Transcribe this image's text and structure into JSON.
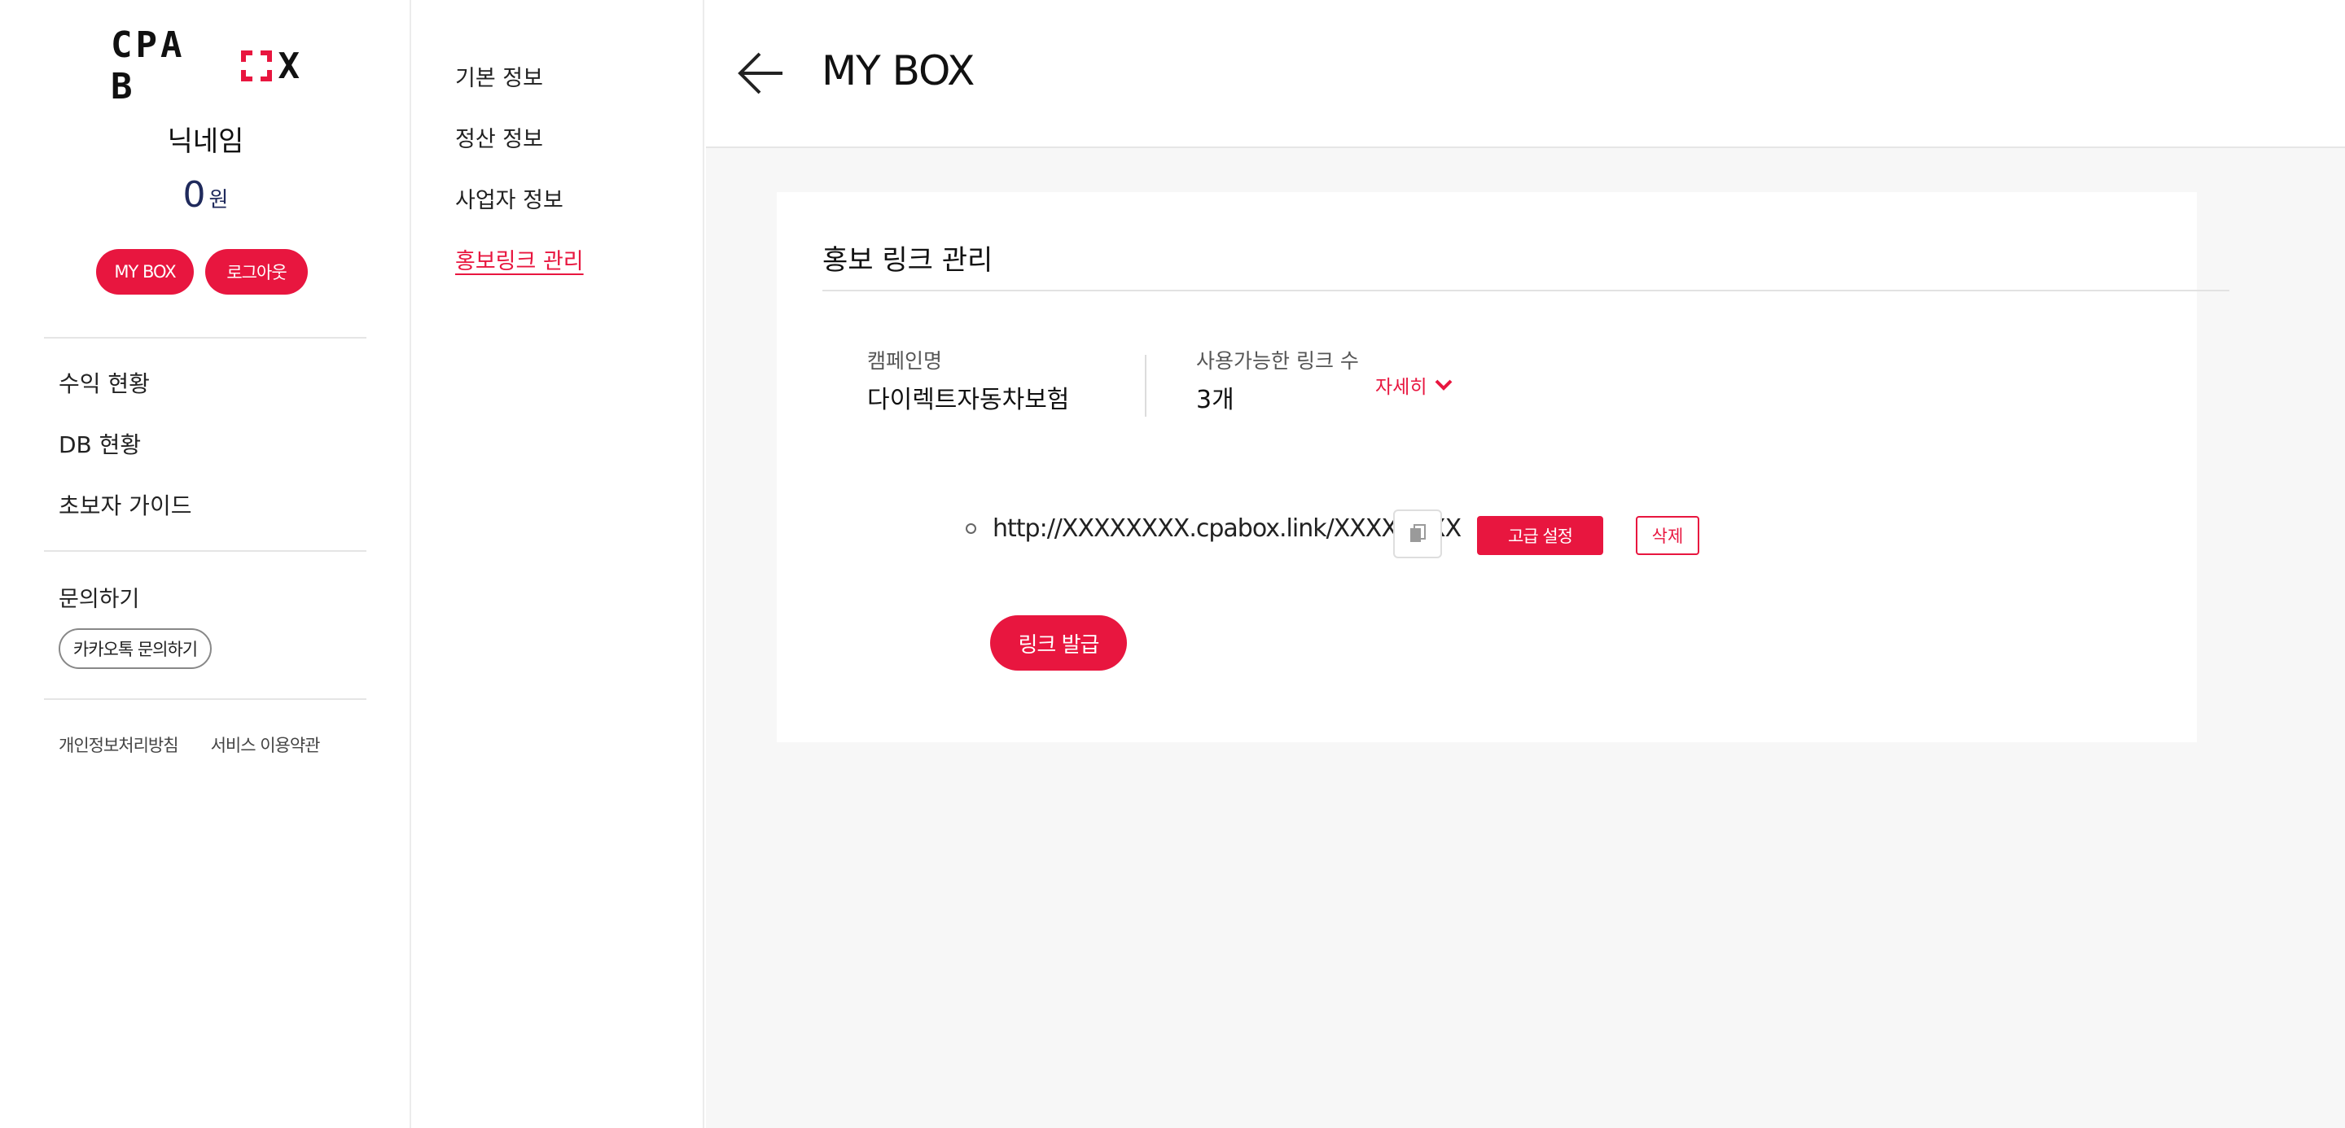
{
  "brand": {
    "logo_left": "CPA B",
    "logo_right": "X",
    "accent_color": "#e8163f"
  },
  "sidebar": {
    "nickname": "닉네임",
    "balance_value": "0",
    "balance_unit": "원",
    "mybox_label": "MY BOX",
    "logout_label": "로그아웃",
    "menu": [
      {
        "label": "수익 현황"
      },
      {
        "label": "DB 현황"
      },
      {
        "label": "초보자 가이드"
      }
    ],
    "inquiry_title": "문의하기",
    "kakao_label": "카카오톡 문의하기",
    "footer": {
      "privacy": "개인정보처리방침",
      "terms": "서비스 이용약관"
    }
  },
  "subnav": {
    "items": [
      {
        "label": "기본 정보"
      },
      {
        "label": "정산 정보"
      },
      {
        "label": "사업자 정보"
      },
      {
        "label": "홍보링크 관리",
        "active": true
      }
    ]
  },
  "header": {
    "back_icon": "arrow-left-icon",
    "title": "MY BOX"
  },
  "promo": {
    "section_title": "홍보 링크 관리",
    "campaign_label": "캠페인명",
    "campaign_value": "다이렉트자동차보험",
    "available_label": "사용가능한 링크 수",
    "available_value": "3개",
    "detail_label": "자세히",
    "link_url": "http://XXXXXXXX.cpabox.link/XXXXXXXX",
    "copy_icon": "copy-icon",
    "advanced_label": "고급 설정",
    "delete_label": "삭제",
    "issue_label": "링크 발급"
  }
}
